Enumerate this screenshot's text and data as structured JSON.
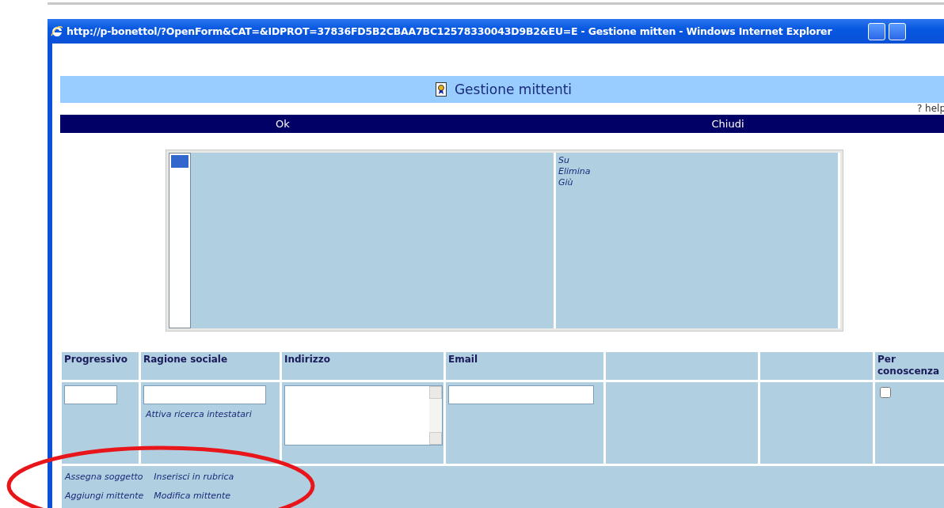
{
  "browser": {
    "title": "http://p-bonettol/?OpenForm&CAT=&IDPROT=37836FD5B2CBAA7BC12578330043D9B2&EU=E - Gestione mitten - Windows Internet Explorer"
  },
  "header": {
    "title": "Gestione mittenti"
  },
  "help_link": "? help",
  "nav": [
    {
      "label": "Ok"
    },
    {
      "label": "Chiudi"
    }
  ],
  "listbox": {
    "items": [
      {
        "selected": true
      }
    ]
  },
  "list_actions": [
    {
      "label": "Su"
    },
    {
      "label": "Elimina"
    },
    {
      "label": "Giù"
    }
  ],
  "columns": [
    {
      "label": "Progressivo"
    },
    {
      "label": "Ragione sociale"
    },
    {
      "label": "Indirizzo"
    },
    {
      "label": "Email"
    },
    {},
    {},
    {
      "label": "Per conoscenza"
    }
  ],
  "entry_row": [
    {
      "kind": "input"
    },
    {
      "kind": "input",
      "link": "Attiva ricerca intestatari"
    },
    {
      "kind": "textarea"
    },
    {
      "kind": "input"
    },
    {
      "kind": "blank"
    },
    {
      "kind": "blank"
    },
    {
      "kind": "checkbox",
      "checked": false
    }
  ],
  "footer_links": [
    {
      "label": "Assegna soggetto"
    },
    {
      "label": "Inserisci in rubrica"
    },
    {
      "label": "Aggiungi mittente"
    },
    {
      "label": "Modifica mittente"
    }
  ]
}
